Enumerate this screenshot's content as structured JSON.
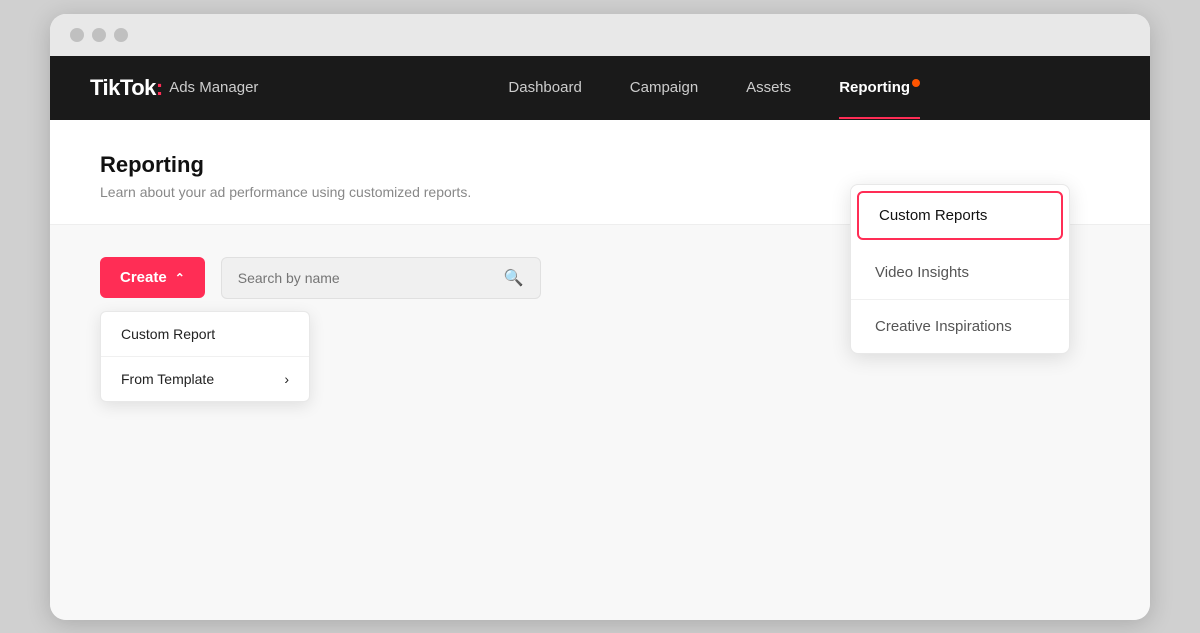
{
  "browser": {
    "dots": [
      "dot1",
      "dot2",
      "dot3"
    ]
  },
  "nav": {
    "logo": {
      "brand": "TikTok",
      "colon": ":",
      "product": "Ads Manager"
    },
    "links": [
      {
        "label": "Dashboard",
        "active": false
      },
      {
        "label": "Campaign",
        "active": false
      },
      {
        "label": "Assets",
        "active": false
      },
      {
        "label": "Reporting",
        "active": true
      }
    ]
  },
  "reporting_page": {
    "title": "Reporting",
    "subtitle": "Learn about your ad performance using customized reports."
  },
  "toolbar": {
    "create_label": "Create",
    "search_placeholder": "Search by name"
  },
  "create_dropdown": {
    "items": [
      {
        "label": "Custom Report",
        "has_arrow": false
      },
      {
        "label": "From Template",
        "has_arrow": true
      }
    ]
  },
  "reporting_dropdown": {
    "items": [
      {
        "label": "Custom Reports",
        "highlighted": true
      },
      {
        "label": "Video Insights",
        "highlighted": false
      },
      {
        "label": "Creative Inspirations",
        "highlighted": false
      }
    ]
  }
}
